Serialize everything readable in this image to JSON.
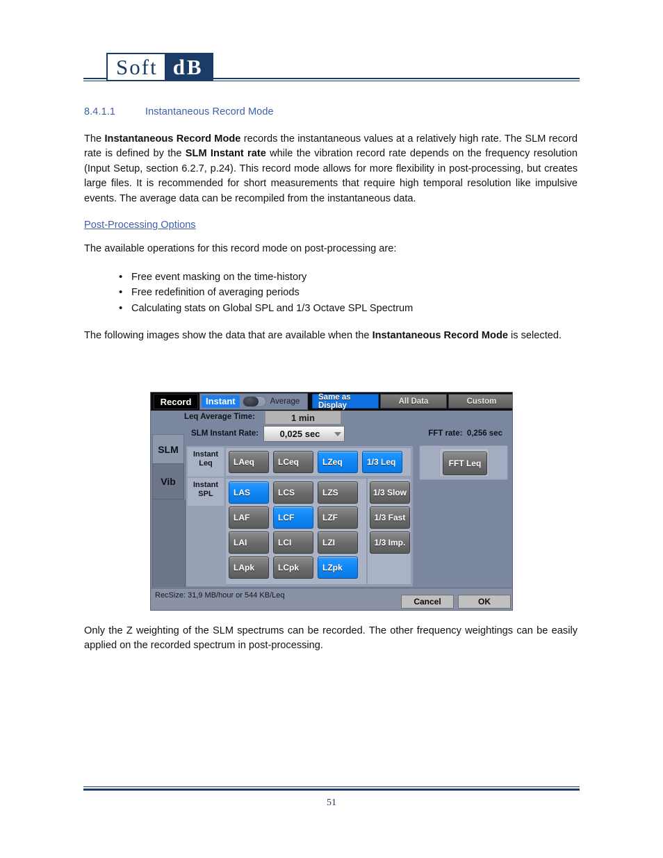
{
  "header": {
    "logo_soft": "Soft",
    "logo_db": "dB"
  },
  "heading": {
    "number": "8.4.1.1",
    "title": "Instantaneous Record Mode"
  },
  "paragraphs": {
    "p1_a": "The ",
    "p1_b1": "Instantaneous Record Mode",
    "p1_c": " records the instantaneous values at a relatively high rate. The SLM record rate is defined by the ",
    "p1_b2": "SLM Instant rate",
    "p1_d": " while the vibration record rate depends on the frequency resolution (Input Setup, section 6.2.7, p.24). This record mode allows for more flexibility in post-processing, but creates large files. It is recommended for short measurements that require high temporal resolution like impulsive events. The average data can be recompiled from the instantaneous data.",
    "subhead": "Post-Processing Options",
    "p2": "The available operations for this record mode on post-processing are:",
    "p3_a": "The following images show the data that are available when the ",
    "p3_b": "Instantaneous Record Mode",
    "p3_c": " is selected.",
    "p4": "Only the Z weighting of the SLM spectrums can be recorded. The other frequency weightings can be easily applied on the recorded spectrum in post-processing."
  },
  "bullets": [
    "Free event masking on the time-history",
    "Free redefinition of averaging periods",
    "Calculating stats on Global SPL and 1/3 Octave SPL Spectrum"
  ],
  "device": {
    "record_label": "Record",
    "toggle_instant": "Instant",
    "toggle_average": "Average",
    "seg_tabs": [
      {
        "label": "Same as Display",
        "active": true
      },
      {
        "label": "All Data",
        "active": false
      },
      {
        "label": "Custom",
        "active": false
      }
    ],
    "leq_avg_label": "Leq Average Time:",
    "leq_avg_value": "1 min",
    "slm_rate_label": "SLM Instant Rate:",
    "slm_rate_value": "0,025 sec",
    "fft_rate_label": "FFT rate:",
    "fft_rate_value": "0,256 sec",
    "vtabs": [
      {
        "label": "SLM",
        "active": true
      },
      {
        "label": "Vib",
        "active": false
      }
    ],
    "group_leq_label": "Instant Leq",
    "group_leq_line1": "Instant",
    "group_leq_line2": "Leq",
    "group_spl_line1": "Instant",
    "group_spl_line2": "SPL",
    "leq_buttons": [
      {
        "label": "LAeq",
        "on": false
      },
      {
        "label": "LCeq",
        "on": false
      },
      {
        "label": "LZeq",
        "on": true
      },
      {
        "label": "1/3 Leq",
        "on": true
      }
    ],
    "spl_rows": [
      [
        {
          "label": "LAS",
          "on": true
        },
        {
          "label": "LCS",
          "on": false
        },
        {
          "label": "LZS",
          "on": false
        },
        {
          "label": "1/3 Slow",
          "on": false
        }
      ],
      [
        {
          "label": "LAF",
          "on": false
        },
        {
          "label": "LCF",
          "on": true
        },
        {
          "label": "LZF",
          "on": false
        },
        {
          "label": "1/3 Fast",
          "on": false
        }
      ],
      [
        {
          "label": "LAI",
          "on": false
        },
        {
          "label": "LCI",
          "on": false
        },
        {
          "label": "LZI",
          "on": false
        },
        {
          "label": "1/3 Imp.",
          "on": false
        }
      ],
      [
        {
          "label": "LApk",
          "on": false
        },
        {
          "label": "LCpk",
          "on": false
        },
        {
          "label": "LZpk",
          "on": true
        },
        {
          "label": "",
          "on": false
        }
      ]
    ],
    "fft_button": "FFT Leq",
    "recsize": "RecSize: 31,9 MB/hour or 544 KB/Leq",
    "cancel_label": "Cancel",
    "ok_label": "OK",
    "accent_blue": "#0d86f5",
    "panel_gray": "#7b869f"
  },
  "footer": {
    "page_number": "51"
  }
}
